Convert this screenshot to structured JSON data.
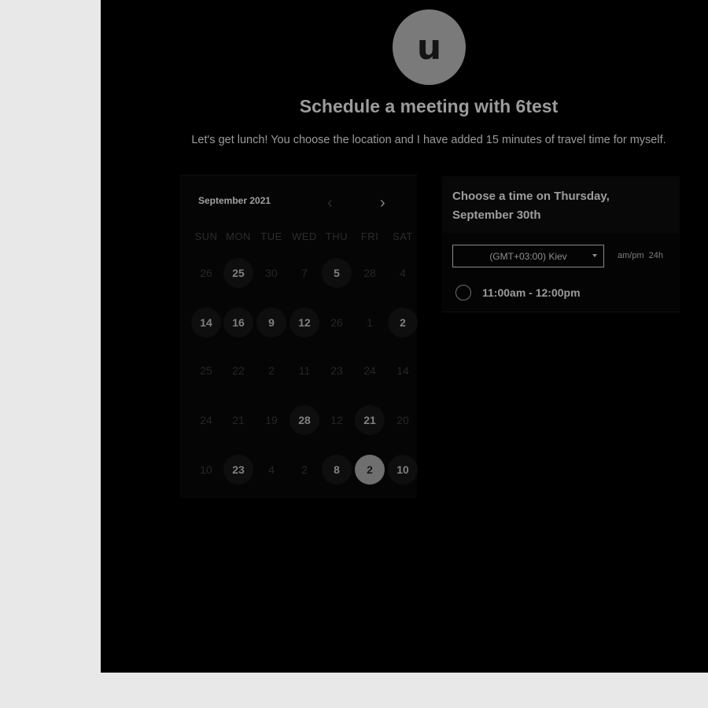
{
  "host": {
    "avatar_initial": "u",
    "title": "Schedule a meeting with 6test",
    "description": "Let's get lunch! You choose the location and I have added 15 minutes of travel time for myself."
  },
  "calendar": {
    "month_label": "September 2021",
    "weekdays": [
      "SUN",
      "MON",
      "TUE",
      "WED",
      "THU",
      "FRI",
      "SAT"
    ],
    "weeks": [
      [
        {
          "day": "26",
          "state": "unavailable"
        },
        {
          "day": "25",
          "state": "available"
        },
        {
          "day": "30",
          "state": "unavailable"
        },
        {
          "day": "7",
          "state": "unavailable"
        },
        {
          "day": "5",
          "state": "available"
        },
        {
          "day": "28",
          "state": "unavailable"
        },
        {
          "day": "4",
          "state": "unavailable"
        }
      ],
      [
        {
          "day": "14",
          "state": "available"
        },
        {
          "day": "16",
          "state": "available"
        },
        {
          "day": "9",
          "state": "available"
        },
        {
          "day": "12",
          "state": "available"
        },
        {
          "day": "26",
          "state": "unavailable"
        },
        {
          "day": "1",
          "state": "unavailable"
        },
        {
          "day": "2",
          "state": "available"
        }
      ],
      [
        {
          "day": "25",
          "state": "unavailable"
        },
        {
          "day": "22",
          "state": "unavailable"
        },
        {
          "day": "2",
          "state": "unavailable"
        },
        {
          "day": "11",
          "state": "unavailable"
        },
        {
          "day": "23",
          "state": "unavailable"
        },
        {
          "day": "24",
          "state": "unavailable"
        },
        {
          "day": "14",
          "state": "unavailable"
        }
      ],
      [
        {
          "day": "24",
          "state": "unavailable"
        },
        {
          "day": "21",
          "state": "unavailable"
        },
        {
          "day": "19",
          "state": "unavailable"
        },
        {
          "day": "28",
          "state": "available"
        },
        {
          "day": "12",
          "state": "unavailable"
        },
        {
          "day": "21",
          "state": "available"
        },
        {
          "day": "20",
          "state": "unavailable"
        }
      ],
      [
        {
          "day": "10",
          "state": "unavailable"
        },
        {
          "day": "23",
          "state": "available"
        },
        {
          "day": "4",
          "state": "unavailable"
        },
        {
          "day": "2",
          "state": "unavailable"
        },
        {
          "day": "8",
          "state": "available"
        },
        {
          "day": "2",
          "state": "selected"
        },
        {
          "day": "10",
          "state": "available"
        }
      ]
    ]
  },
  "times": {
    "heading": "Choose a time on Thursday, September 30th",
    "timezone": "(GMT+03:00) Kiev",
    "format_ampm": "am/pm",
    "format_24h": "24h",
    "slots": [
      "11:00am - 12:00pm"
    ]
  }
}
